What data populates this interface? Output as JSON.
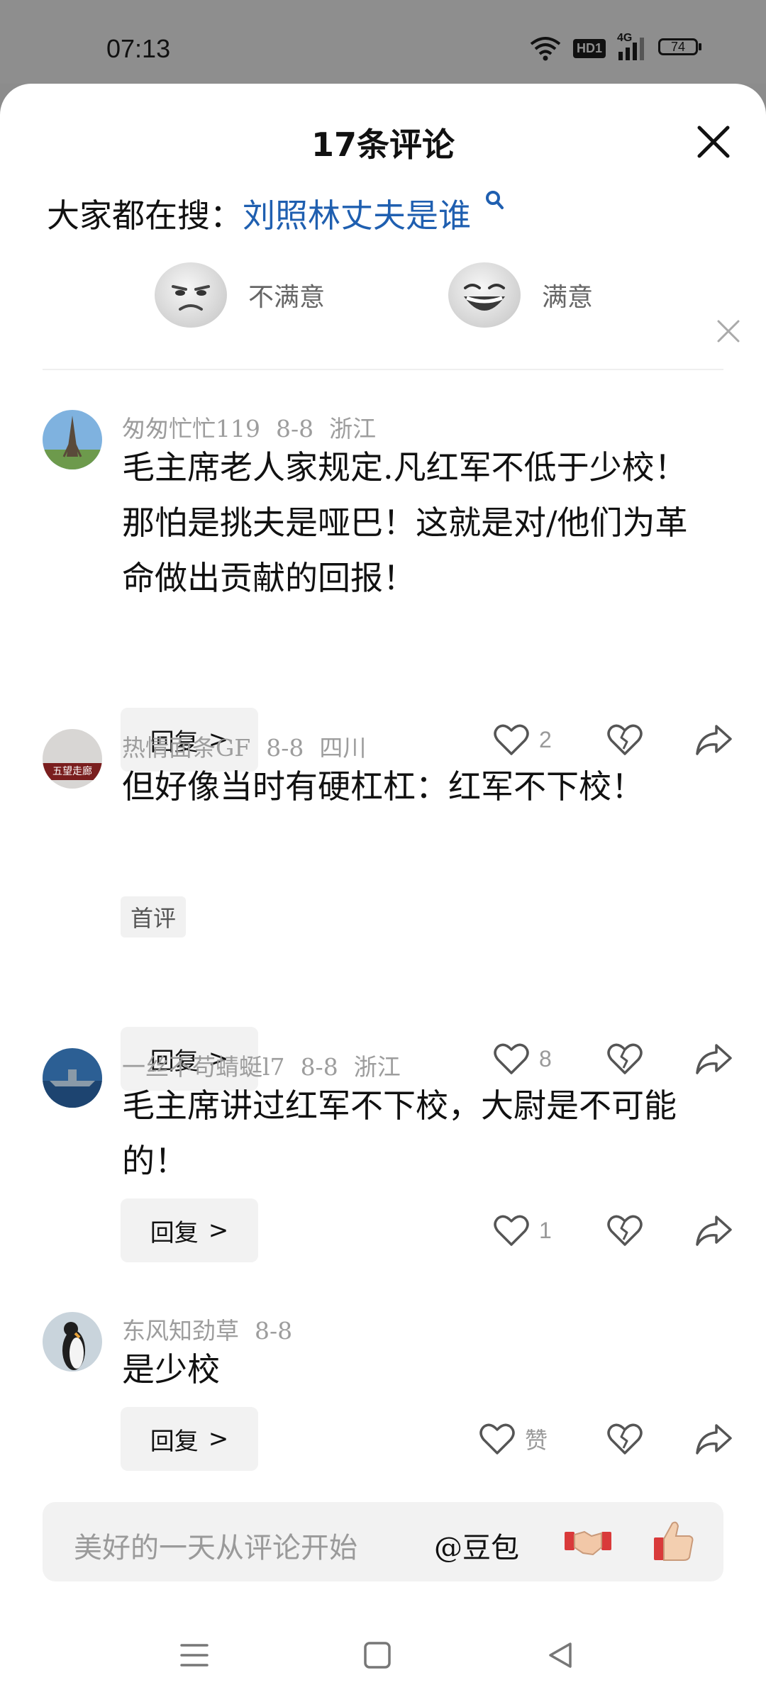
{
  "status": {
    "time": "07:13",
    "battery": "74",
    "network": "4G",
    "hd": "HD1"
  },
  "sheet": {
    "title": "17条评论"
  },
  "search": {
    "prefix": "大家都在搜：",
    "query": "刘照林丈夫是谁"
  },
  "feedback": {
    "unsatisfied": "不满意",
    "satisfied": "满意"
  },
  "comments": [
    {
      "user": "匆匆忙忙119",
      "date": "8-8",
      "region": "浙江",
      "text": "毛主席老人家规定.凡红军不低于少校！那怕是挑夫是哑巴！这就是对/他们为革命做出贡献的回报！",
      "likes": "2",
      "avatar": "eiffel-tower"
    },
    {
      "user": "热情面条GF",
      "date": "8-8",
      "region": "四川",
      "text": "但好像当时有硬杠杠：红军不下校！",
      "tag": "首评",
      "likes": "8",
      "avatar_text": "五望走廊"
    },
    {
      "user": "一丝不苟蜻蜓l7",
      "date": "8-8",
      "region": "浙江",
      "text": "毛主席讲过红军不下校，大尉是不可能的！",
      "likes": "1",
      "avatar": "warship"
    },
    {
      "user": "东风知劲草",
      "date": "8-8",
      "region": "",
      "text": "是少校",
      "likes": "赞",
      "avatar": "penguin"
    }
  ],
  "actions": {
    "reply": "回复"
  },
  "input": {
    "placeholder": "美好的一天从评论开始",
    "mention": "@豆包"
  }
}
